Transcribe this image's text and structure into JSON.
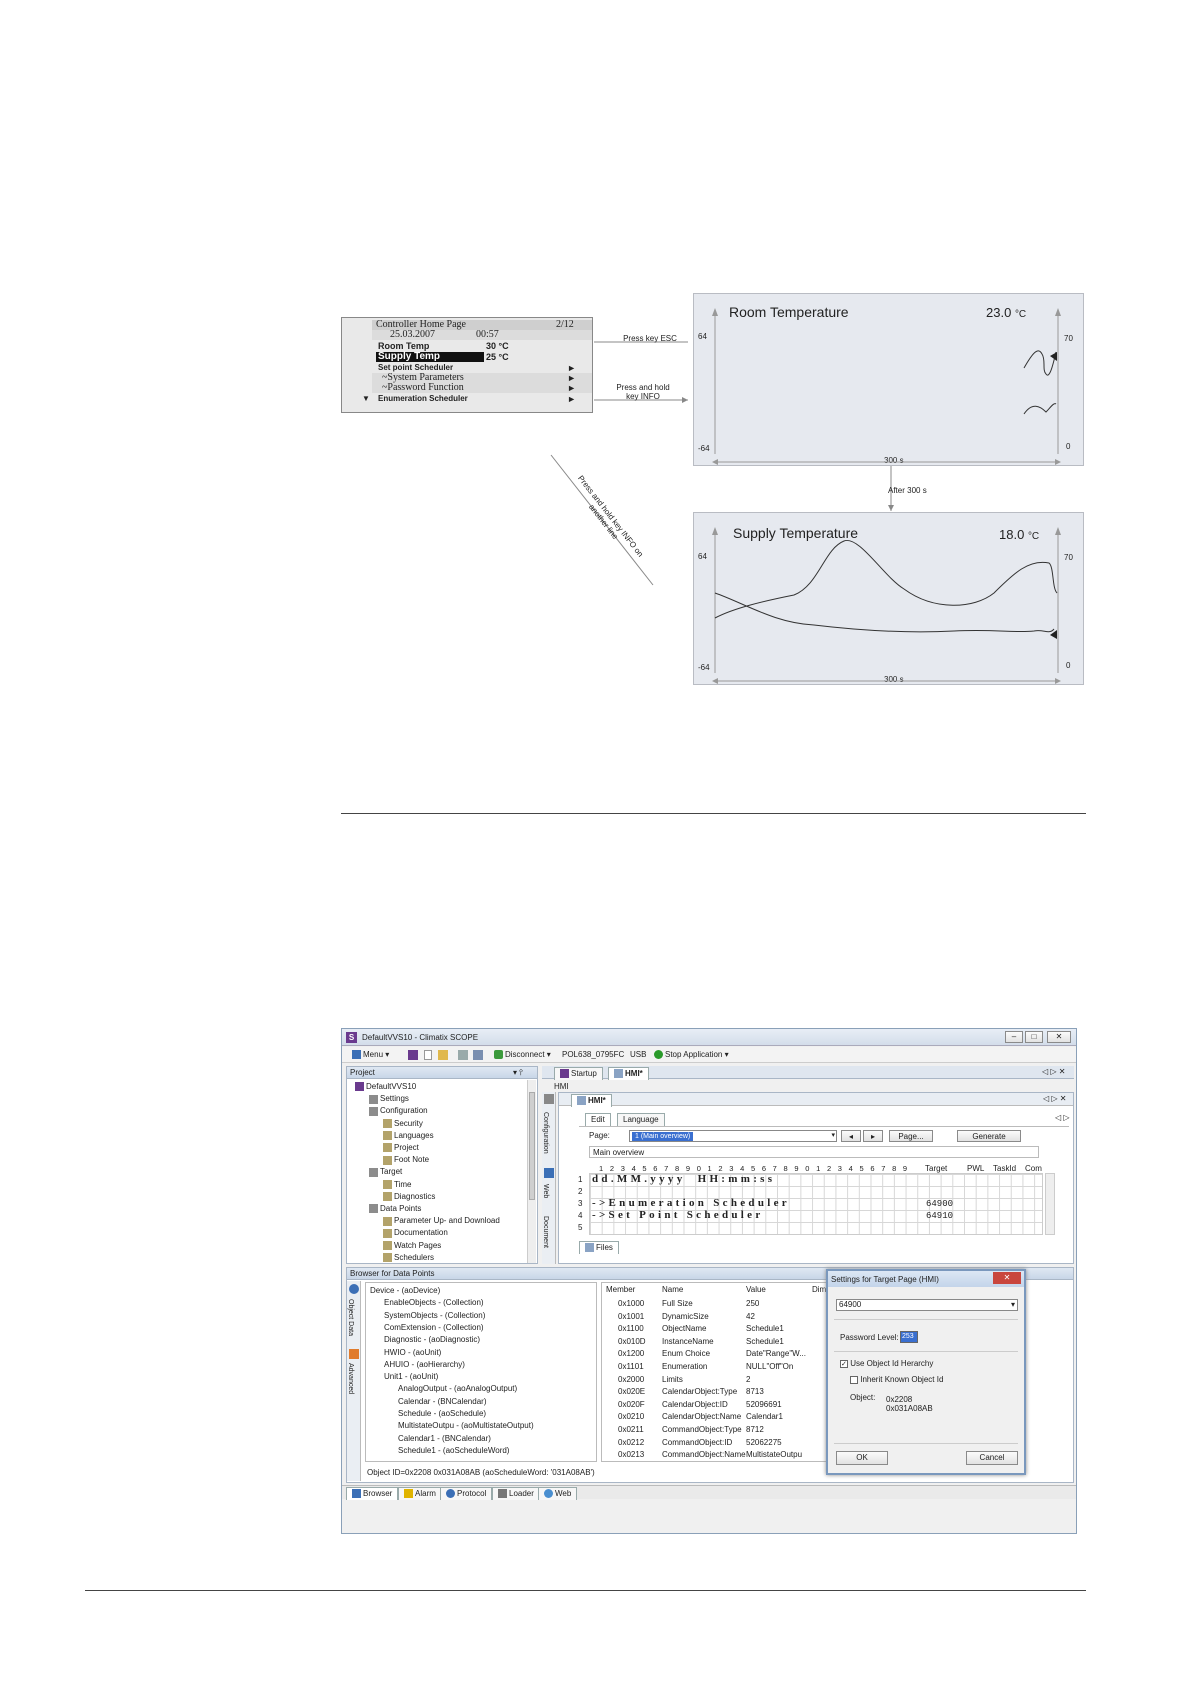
{
  "figure1": {
    "lcd": {
      "header_title": "Controller Home Page",
      "header_page": "2/12",
      "date": "25.03.2007",
      "time": "00:57",
      "rows": [
        {
          "label": "Room Temp",
          "value": "30 °C"
        },
        {
          "label": "Supply Temp",
          "value": "25 °C"
        },
        {
          "label": "Set point Scheduler",
          "arrow": "►"
        },
        {
          "label": "~System Parameters",
          "arrow": "►"
        },
        {
          "label": "~Password Function",
          "arrow": "►"
        },
        {
          "label": "Enumeration Scheduler",
          "arrow": "►"
        }
      ],
      "scroll_marker": "▼"
    },
    "annotations": {
      "esc": "Press key ESC",
      "info": "Press and hold key INFO",
      "diagonal": "Press and hold key INFO on another line",
      "after": "After 300 s"
    },
    "room_trend": {
      "title": "Room Temperature",
      "value": "23.0",
      "unit": "°C",
      "left_top": "64",
      "left_bottom": "-64",
      "right_top": "70",
      "right_bottom": "0",
      "x_span": "300 s"
    },
    "supply_trend": {
      "title": "Supply Temperature",
      "value": "18.0",
      "unit": "°C",
      "left_top": "64",
      "left_bottom": "-64",
      "right_top": "70",
      "right_bottom": "0",
      "x_span": "300 s"
    }
  },
  "scope": {
    "window_title": "DefaultVVS10 - Climatix SCOPE",
    "toolbar": {
      "menu": "Menu",
      "disconnect": "Disconnect",
      "device": "POL638_0795FC",
      "usb": "USB",
      "stop_app": "Stop Application"
    },
    "project": {
      "title": "Project",
      "items": [
        {
          "label": "DefaultVVS10",
          "level": 0
        },
        {
          "label": "Settings",
          "level": 1
        },
        {
          "label": "Configuration",
          "level": 1
        },
        {
          "label": "Security",
          "level": 2
        },
        {
          "label": "Languages",
          "level": 2
        },
        {
          "label": "Project",
          "level": 2
        },
        {
          "label": "Foot Note",
          "level": 2
        },
        {
          "label": "Target",
          "level": 1
        },
        {
          "label": "Time",
          "level": 2
        },
        {
          "label": "Diagnostics",
          "level": 2
        },
        {
          "label": "Data Points",
          "level": 1
        },
        {
          "label": "Parameter Up- and Download",
          "level": 2
        },
        {
          "label": "Documentation",
          "level": 2
        },
        {
          "label": "Watch Pages",
          "level": 2
        },
        {
          "label": "Schedulers",
          "level": 2
        }
      ]
    },
    "doc_tabs": {
      "startup": "Startup",
      "hmi": "HMI*",
      "hmi_label": "HMI",
      "inner_hmi": "HMI*"
    },
    "side_tabs": [
      "Configuration",
      "Web",
      "Document"
    ],
    "hmi_editor": {
      "tab_edit": "Edit",
      "tab_language": "Language",
      "page_label": "Page:",
      "page_value": "1 (Main overview)",
      "page_button": "Page...",
      "generate_button": "Generate",
      "title_value": "Main overview",
      "column_numbers": "1 2 3 4 5 6 7 8 9 0 1 2 3 4 5 6 7 8 9 0 1 2 3 4 5 6 7 8 9",
      "columns": [
        "Target",
        "PWL",
        "TaskId",
        "Com"
      ],
      "rows": [
        {
          "num": "1",
          "text": "dd.MM.yyyy  HH:mm:ss",
          "target": ""
        },
        {
          "num": "2",
          "text": "",
          "target": ""
        },
        {
          "num": "3",
          "text": "->Enumeration Scheduler",
          "target": "64900"
        },
        {
          "num": "4",
          "text": "->Set Point Scheduler",
          "target": "64910"
        },
        {
          "num": "5",
          "text": "",
          "target": ""
        }
      ],
      "files_tab": "Files"
    },
    "browser": {
      "title": "Browser for Data Points",
      "side_tabs": [
        "Object Data",
        "Advanced"
      ],
      "tree": [
        {
          "label": "Device - (aoDevice)",
          "level": 0
        },
        {
          "label": "EnableObjects - (Collection)",
          "level": 1
        },
        {
          "label": "SystemObjects - (Collection)",
          "level": 1
        },
        {
          "label": "ComExtension - (Collection)",
          "level": 1
        },
        {
          "label": "Diagnostic - (aoDiagnostic)",
          "level": 1
        },
        {
          "label": "HWIO - (aoUnit)",
          "level": 1
        },
        {
          "label": "AHUIO - (aoHierarchy)",
          "level": 1
        },
        {
          "label": "Unit1 - (aoUnit)",
          "level": 1
        },
        {
          "label": "AnalogOutput - (aoAnalogOutput)",
          "level": 2
        },
        {
          "label": "Calendar - (BNCalendar)",
          "level": 2
        },
        {
          "label": "Schedule - (aoSchedule)",
          "level": 2
        },
        {
          "label": "MultistateOutpu - (aoMultistateOutput)",
          "level": 2
        },
        {
          "label": "Calendar1 - (BNCalendar)",
          "level": 2
        },
        {
          "label": "Schedule1 - (aoScheduleWord)",
          "level": 2
        }
      ],
      "columns": [
        "Member",
        "Name",
        "Value",
        "Dim"
      ],
      "rows": [
        [
          "0x1000",
          "Full Size",
          "250"
        ],
        [
          "0x1001",
          "DynamicSize",
          "42"
        ],
        [
          "0x1100",
          "ObjectName",
          "Schedule1"
        ],
        [
          "0x010D",
          "InstanceName",
          "Schedule1"
        ],
        [
          "0x1200",
          "Enum Choice",
          "Date\"Range\"W..."
        ],
        [
          "0x1101",
          "Enumeration",
          "NULL\"Off\"On"
        ],
        [
          "0x2000",
          "Limits",
          "2"
        ],
        [
          "0x020E",
          "CalendarObject:Type",
          "8713"
        ],
        [
          "0x020F",
          "CalendarObject:ID",
          "52096691"
        ],
        [
          "0x0210",
          "CalendarObject:Name",
          "Calendar1"
        ],
        [
          "0x0211",
          "CommandObject:Type",
          "8712"
        ],
        [
          "0x0212",
          "CommandObject:ID",
          "52062275"
        ],
        [
          "0x0213",
          "CommandObject:Name",
          "MultistateOutpu"
        ]
      ],
      "status": "Object ID=0x2208 0x031A08AB (aoScheduleWord: '031A08AB')"
    },
    "dialog": {
      "title": "Settings for Target Page (HMI)",
      "combo_value": "64900",
      "password_label": "Password Level:",
      "password_value": "253",
      "check_hierarchy": "Use Object Id Herarchy",
      "check_inherit": "Inherit Known Object Id",
      "object_label": "Object:",
      "object_value1": "0x2208",
      "object_value2": "0x031A08AB",
      "ok": "OK",
      "cancel": "Cancel"
    },
    "bottom_tabs": [
      "Browser",
      "Alarm",
      "Protocol",
      "Loader",
      "Web"
    ]
  }
}
